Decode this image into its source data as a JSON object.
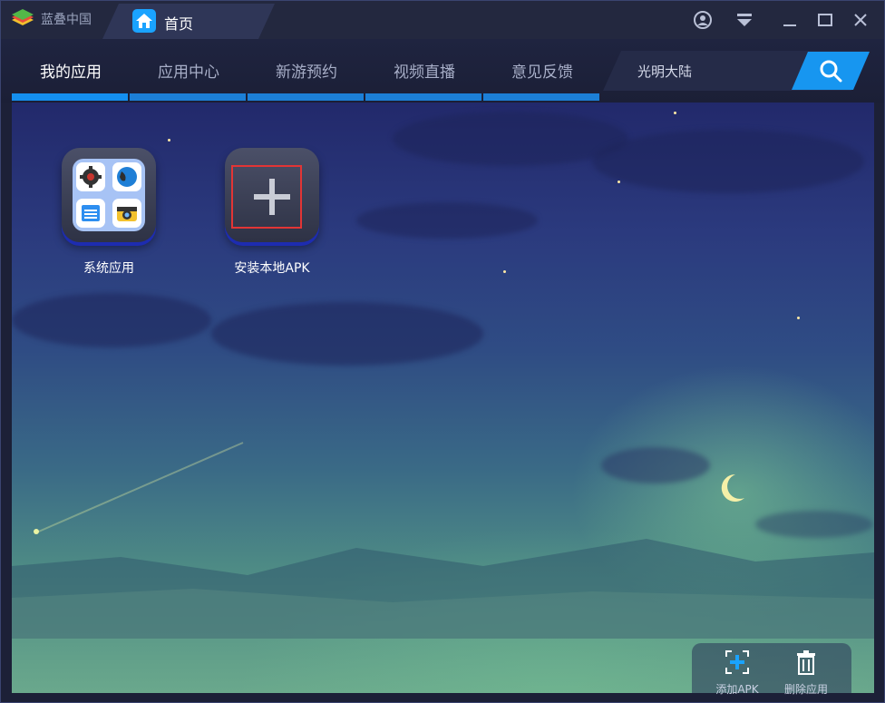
{
  "titlebar": {
    "brand": "蓝叠中国",
    "tab_label": "首页"
  },
  "nav": {
    "items": [
      {
        "label": "我的应用",
        "active": true
      },
      {
        "label": "应用中心",
        "active": false
      },
      {
        "label": "新游预约",
        "active": false
      },
      {
        "label": "视频直播",
        "active": false
      },
      {
        "label": "意见反馈",
        "active": false
      }
    ]
  },
  "search": {
    "value": "光明大陆"
  },
  "apps": [
    {
      "label": "系统应用"
    },
    {
      "label": "安装本地APK"
    }
  ],
  "bottom": {
    "add_apk": "添加APK",
    "delete_app": "删除应用"
  },
  "colors": {
    "accent": "#1796f0",
    "highlight_frame": "#e23535"
  }
}
